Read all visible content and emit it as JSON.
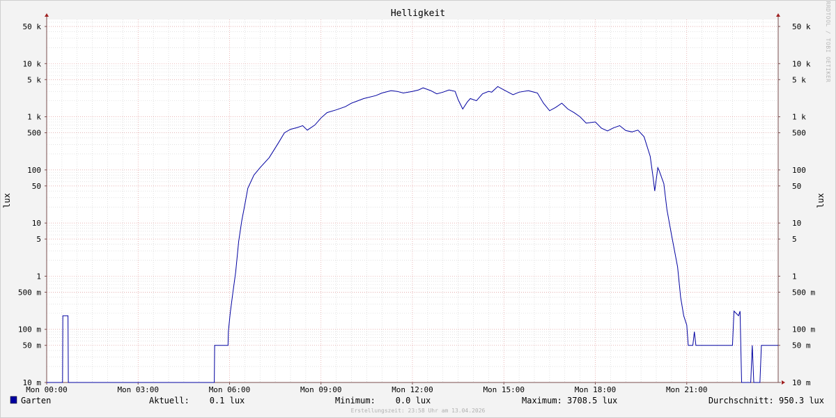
{
  "chart_data": {
    "type": "line",
    "title": "Helligkeit",
    "ylabel": "lux",
    "y_scale": "log",
    "ylim": [
      0.01,
      80000
    ],
    "xlim": [
      0,
      24
    ],
    "x_ticks": [
      {
        "v": 0,
        "label": "Mon 00:00"
      },
      {
        "v": 3,
        "label": "Mon 03:00"
      },
      {
        "v": 6,
        "label": "Mon 06:00"
      },
      {
        "v": 9,
        "label": "Mon 09:00"
      },
      {
        "v": 12,
        "label": "Mon 12:00"
      },
      {
        "v": 15,
        "label": "Mon 15:00"
      },
      {
        "v": 18,
        "label": "Mon 18:00"
      },
      {
        "v": 21,
        "label": "Mon 21:00"
      }
    ],
    "y_ticks": [
      {
        "v": 50000,
        "label": "50 k"
      },
      {
        "v": 10000,
        "label": "10 k"
      },
      {
        "v": 5000,
        "label": "5 k"
      },
      {
        "v": 1000,
        "label": "1 k"
      },
      {
        "v": 500,
        "label": "500"
      },
      {
        "v": 100,
        "label": "100"
      },
      {
        "v": 50,
        "label": "50"
      },
      {
        "v": 10,
        "label": "10"
      },
      {
        "v": 5,
        "label": "5"
      },
      {
        "v": 1,
        "label": "1"
      },
      {
        "v": 0.5,
        "label": "500 m"
      },
      {
        "v": 0.1,
        "label": "100 m"
      },
      {
        "v": 0.05,
        "label": "50 m"
      },
      {
        "v": 0.01,
        "label": "10 m"
      }
    ],
    "grid": true,
    "colors": {
      "series": "#0000a0",
      "major_grid": "#e39b9b",
      "minor_grid": "#cfcfcf",
      "axis": "#7a4d4d",
      "arrow": "#a02020"
    },
    "series": [
      {
        "name": "Garten",
        "color": "#0000a0",
        "points": [
          [
            0.0,
            0.01
          ],
          [
            0.52,
            0.01
          ],
          [
            0.53,
            0.18
          ],
          [
            0.7,
            0.18
          ],
          [
            0.71,
            0.01
          ],
          [
            5.5,
            0.01
          ],
          [
            5.51,
            0.05
          ],
          [
            5.95,
            0.05
          ],
          [
            5.96,
            0.09
          ],
          [
            6.02,
            0.2
          ],
          [
            6.1,
            0.45
          ],
          [
            6.2,
            1.2
          ],
          [
            6.3,
            4.5
          ],
          [
            6.4,
            11
          ],
          [
            6.5,
            22
          ],
          [
            6.6,
            45
          ],
          [
            6.8,
            80
          ],
          [
            7.0,
            110
          ],
          [
            7.3,
            170
          ],
          [
            7.6,
            320
          ],
          [
            7.8,
            500
          ],
          [
            8.0,
            580
          ],
          [
            8.2,
            620
          ],
          [
            8.4,
            680
          ],
          [
            8.55,
            560
          ],
          [
            8.8,
            700
          ],
          [
            9.0,
            950
          ],
          [
            9.2,
            1200
          ],
          [
            9.5,
            1350
          ],
          [
            9.8,
            1550
          ],
          [
            10.0,
            1800
          ],
          [
            10.4,
            2200
          ],
          [
            10.8,
            2500
          ],
          [
            11.0,
            2800
          ],
          [
            11.3,
            3100
          ],
          [
            11.5,
            3000
          ],
          [
            11.7,
            2800
          ],
          [
            12.0,
            3000
          ],
          [
            12.2,
            3200
          ],
          [
            12.35,
            3500
          ],
          [
            12.6,
            3100
          ],
          [
            12.8,
            2700
          ],
          [
            13.0,
            2900
          ],
          [
            13.2,
            3200
          ],
          [
            13.4,
            3000
          ],
          [
            13.5,
            2100
          ],
          [
            13.65,
            1400
          ],
          [
            13.8,
            1900
          ],
          [
            13.9,
            2200
          ],
          [
            14.1,
            2000
          ],
          [
            14.3,
            2700
          ],
          [
            14.5,
            3000
          ],
          [
            14.6,
            2900
          ],
          [
            14.8,
            3708.5
          ],
          [
            15.0,
            3200
          ],
          [
            15.3,
            2600
          ],
          [
            15.5,
            2900
          ],
          [
            15.8,
            3100
          ],
          [
            16.1,
            2800
          ],
          [
            16.3,
            1800
          ],
          [
            16.5,
            1300
          ],
          [
            16.7,
            1500
          ],
          [
            16.9,
            1800
          ],
          [
            17.1,
            1400
          ],
          [
            17.3,
            1200
          ],
          [
            17.5,
            1000
          ],
          [
            17.7,
            760
          ],
          [
            18.0,
            800
          ],
          [
            18.2,
            610
          ],
          [
            18.4,
            540
          ],
          [
            18.6,
            620
          ],
          [
            18.8,
            680
          ],
          [
            19.0,
            550
          ],
          [
            19.2,
            520
          ],
          [
            19.4,
            560
          ],
          [
            19.6,
            420
          ],
          [
            19.8,
            180
          ],
          [
            19.9,
            70
          ],
          [
            19.95,
            40
          ],
          [
            20.05,
            110
          ],
          [
            20.1,
            95
          ],
          [
            20.25,
            55
          ],
          [
            20.35,
            18
          ],
          [
            20.5,
            6
          ],
          [
            20.7,
            1.5
          ],
          [
            20.8,
            0.4
          ],
          [
            20.9,
            0.18
          ],
          [
            21.0,
            0.12
          ],
          [
            21.05,
            0.05
          ],
          [
            21.2,
            0.05
          ],
          [
            21.25,
            0.09
          ],
          [
            21.3,
            0.05
          ],
          [
            22.5,
            0.05
          ],
          [
            22.55,
            0.22
          ],
          [
            22.7,
            0.18
          ],
          [
            22.75,
            0.22
          ],
          [
            22.8,
            0.01
          ],
          [
            23.1,
            0.01
          ],
          [
            23.15,
            0.05
          ],
          [
            23.2,
            0.01
          ],
          [
            23.4,
            0.01
          ],
          [
            23.45,
            0.05
          ],
          [
            24.0,
            0.05
          ]
        ]
      }
    ]
  },
  "legend": {
    "series_name": "Garten",
    "swatch_color": "#0000a0",
    "current": "Aktuell:    0.1 lux",
    "minimum": "Minimum:    0.0 lux",
    "maximum": "Maximum: 3708.5 lux",
    "average": "Durchschnitt: 950.3 lux"
  },
  "footer": "Erstellungszeit: 23:58 Uhr am 13.04.2026",
  "watermark": "RRDTOOL / TOBI OETIKER"
}
